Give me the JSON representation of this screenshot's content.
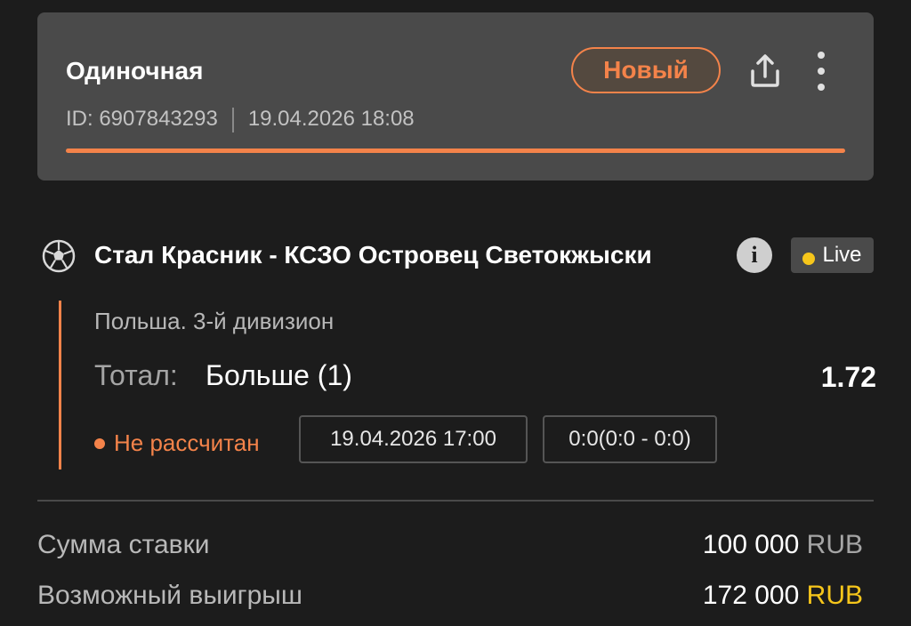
{
  "header": {
    "bet_type": "Одиночная",
    "id_text": "ID: 6907843293",
    "datetime": "19.04.2026 18:08",
    "status": "Новый",
    "progress_fraction": 1.0
  },
  "event": {
    "match_title": "Стал Красник - КСЗО Островец Светокжыски",
    "live_label": "Live",
    "league": "Польша. 3-й дивизион",
    "market_label": "Тотал:",
    "market_value": "Больше (1)",
    "odds": "1.72",
    "settle_status": "Не рассчитан",
    "start_time": "19.04.2026 17:00",
    "score": "0:0(0:0 - 0:0)"
  },
  "summary": {
    "stake_label": "Сумма ставки",
    "stake_amount": "100 000",
    "stake_currency": "RUB",
    "win_label": "Возможный выигрыш",
    "win_amount": "172 000",
    "win_currency": "RUB"
  },
  "icons": {
    "sport": "soccer-ball-icon",
    "share": "share-icon",
    "more": "more-vertical-icon",
    "info": "info-icon"
  },
  "colors": {
    "accent": "#f4834a",
    "live_dot": "#f6c61b",
    "win_currency": "#f6c61b",
    "card_bg": "#4a4a4a",
    "page_bg": "#1c1c1c"
  }
}
